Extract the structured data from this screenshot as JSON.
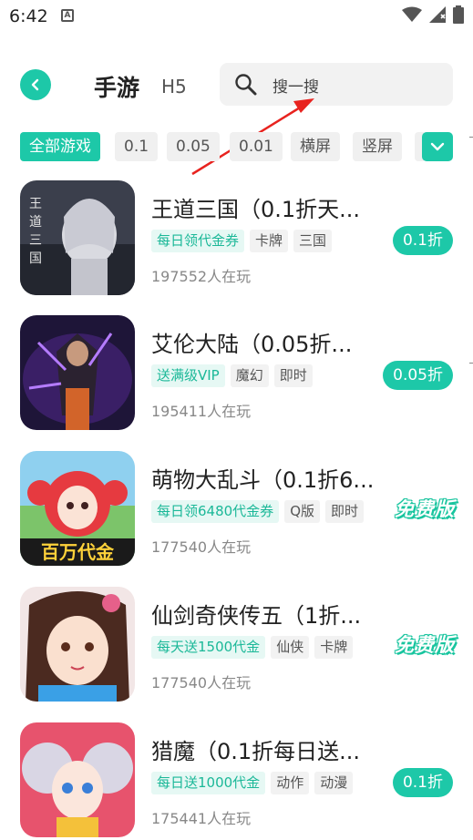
{
  "status_bar": {
    "time": "6:42",
    "notif_letter": "A"
  },
  "header": {
    "tab_mobile": "手游",
    "tab_h5": "H5",
    "search_placeholder": "搜一搜"
  },
  "filters": [
    "全部游戏",
    "0.1",
    "0.05",
    "0.01",
    "横屏",
    "竖屏"
  ],
  "games": [
    {
      "title": "王道三国（0.1折天...",
      "tags": [
        {
          "label": "每日领代金券",
          "promo": true
        },
        {
          "label": "卡牌",
          "promo": false
        },
        {
          "label": "三国",
          "promo": false
        }
      ],
      "players": "197552人在玩",
      "badge": "0.1折",
      "badge_type": "discount",
      "icon_colors": [
        "#2a2e3a",
        "#c8c9d2"
      ]
    },
    {
      "title": "艾伦大陆（0.05折...",
      "tags": [
        {
          "label": "送满级VIP",
          "promo": true
        },
        {
          "label": "魔幻",
          "promo": false
        },
        {
          "label": "即时",
          "promo": false
        }
      ],
      "players": "195411人在玩",
      "badge": "0.05折",
      "badge_type": "discount",
      "icon_colors": [
        "#1d1436",
        "#8e4bd6"
      ]
    },
    {
      "title": "萌物大乱斗（0.1折6...",
      "tags": [
        {
          "label": "每日领6480代金券",
          "promo": true
        },
        {
          "label": "Q版",
          "promo": false
        },
        {
          "label": "即时",
          "promo": false
        }
      ],
      "players": "177540人在玩",
      "badge": "免费版",
      "badge_type": "free",
      "icon_colors": [
        "#7fc6ea",
        "#e8363d"
      ],
      "icon_text": "百万代金"
    },
    {
      "title": "仙剑奇侠传五（1折...",
      "tags": [
        {
          "label": "每天送1500代金",
          "promo": true
        },
        {
          "label": "仙侠",
          "promo": false
        },
        {
          "label": "卡牌",
          "promo": false
        }
      ],
      "players": "177540人在玩",
      "badge": "免费版",
      "badge_type": "free",
      "icon_colors": [
        "#6a3a2a",
        "#f3d7c8"
      ]
    },
    {
      "title": "猎魔（0.1折每日送...",
      "tags": [
        {
          "label": "每日送1000代金",
          "promo": true
        },
        {
          "label": "动作",
          "promo": false
        },
        {
          "label": "动漫",
          "promo": false
        }
      ],
      "players": "175441人在玩",
      "badge": "0.1折",
      "badge_type": "discount",
      "icon_colors": [
        "#d8d4e4",
        "#e26a8a"
      ]
    }
  ],
  "colors": {
    "accent": "#1dc8a8",
    "arrow": "#e8231f"
  }
}
